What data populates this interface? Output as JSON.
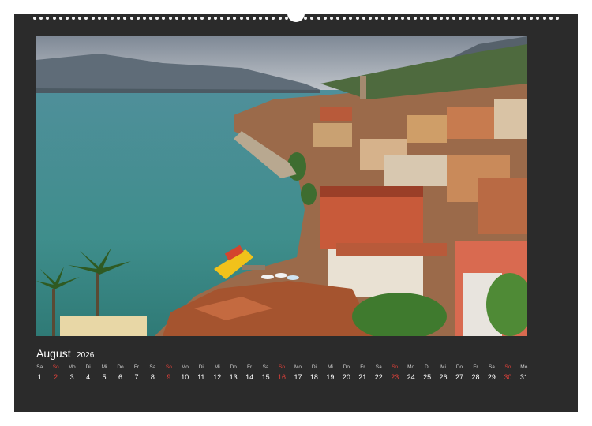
{
  "calendar": {
    "month": "August",
    "year": "2026",
    "accent_sunday": "#e0413a",
    "days": [
      {
        "wd": "Sa",
        "n": "1"
      },
      {
        "wd": "So",
        "n": "2"
      },
      {
        "wd": "Mo",
        "n": "3"
      },
      {
        "wd": "Di",
        "n": "4"
      },
      {
        "wd": "Mi",
        "n": "5"
      },
      {
        "wd": "Do",
        "n": "6"
      },
      {
        "wd": "Fr",
        "n": "7"
      },
      {
        "wd": "Sa",
        "n": "8"
      },
      {
        "wd": "So",
        "n": "9"
      },
      {
        "wd": "Mo",
        "n": "10"
      },
      {
        "wd": "Di",
        "n": "11"
      },
      {
        "wd": "Mi",
        "n": "12"
      },
      {
        "wd": "Do",
        "n": "13"
      },
      {
        "wd": "Fr",
        "n": "14"
      },
      {
        "wd": "Sa",
        "n": "15"
      },
      {
        "wd": "So",
        "n": "16"
      },
      {
        "wd": "Mo",
        "n": "17"
      },
      {
        "wd": "Di",
        "n": "18"
      },
      {
        "wd": "Mi",
        "n": "19"
      },
      {
        "wd": "Do",
        "n": "20"
      },
      {
        "wd": "Fr",
        "n": "21"
      },
      {
        "wd": "Sa",
        "n": "22"
      },
      {
        "wd": "So",
        "n": "23"
      },
      {
        "wd": "Mo",
        "n": "24"
      },
      {
        "wd": "Di",
        "n": "25"
      },
      {
        "wd": "Mi",
        "n": "26"
      },
      {
        "wd": "Do",
        "n": "27"
      },
      {
        "wd": "Fr",
        "n": "28"
      },
      {
        "wd": "Sa",
        "n": "29"
      },
      {
        "wd": "So",
        "n": "30"
      },
      {
        "wd": "Mo",
        "n": "31"
      }
    ]
  }
}
